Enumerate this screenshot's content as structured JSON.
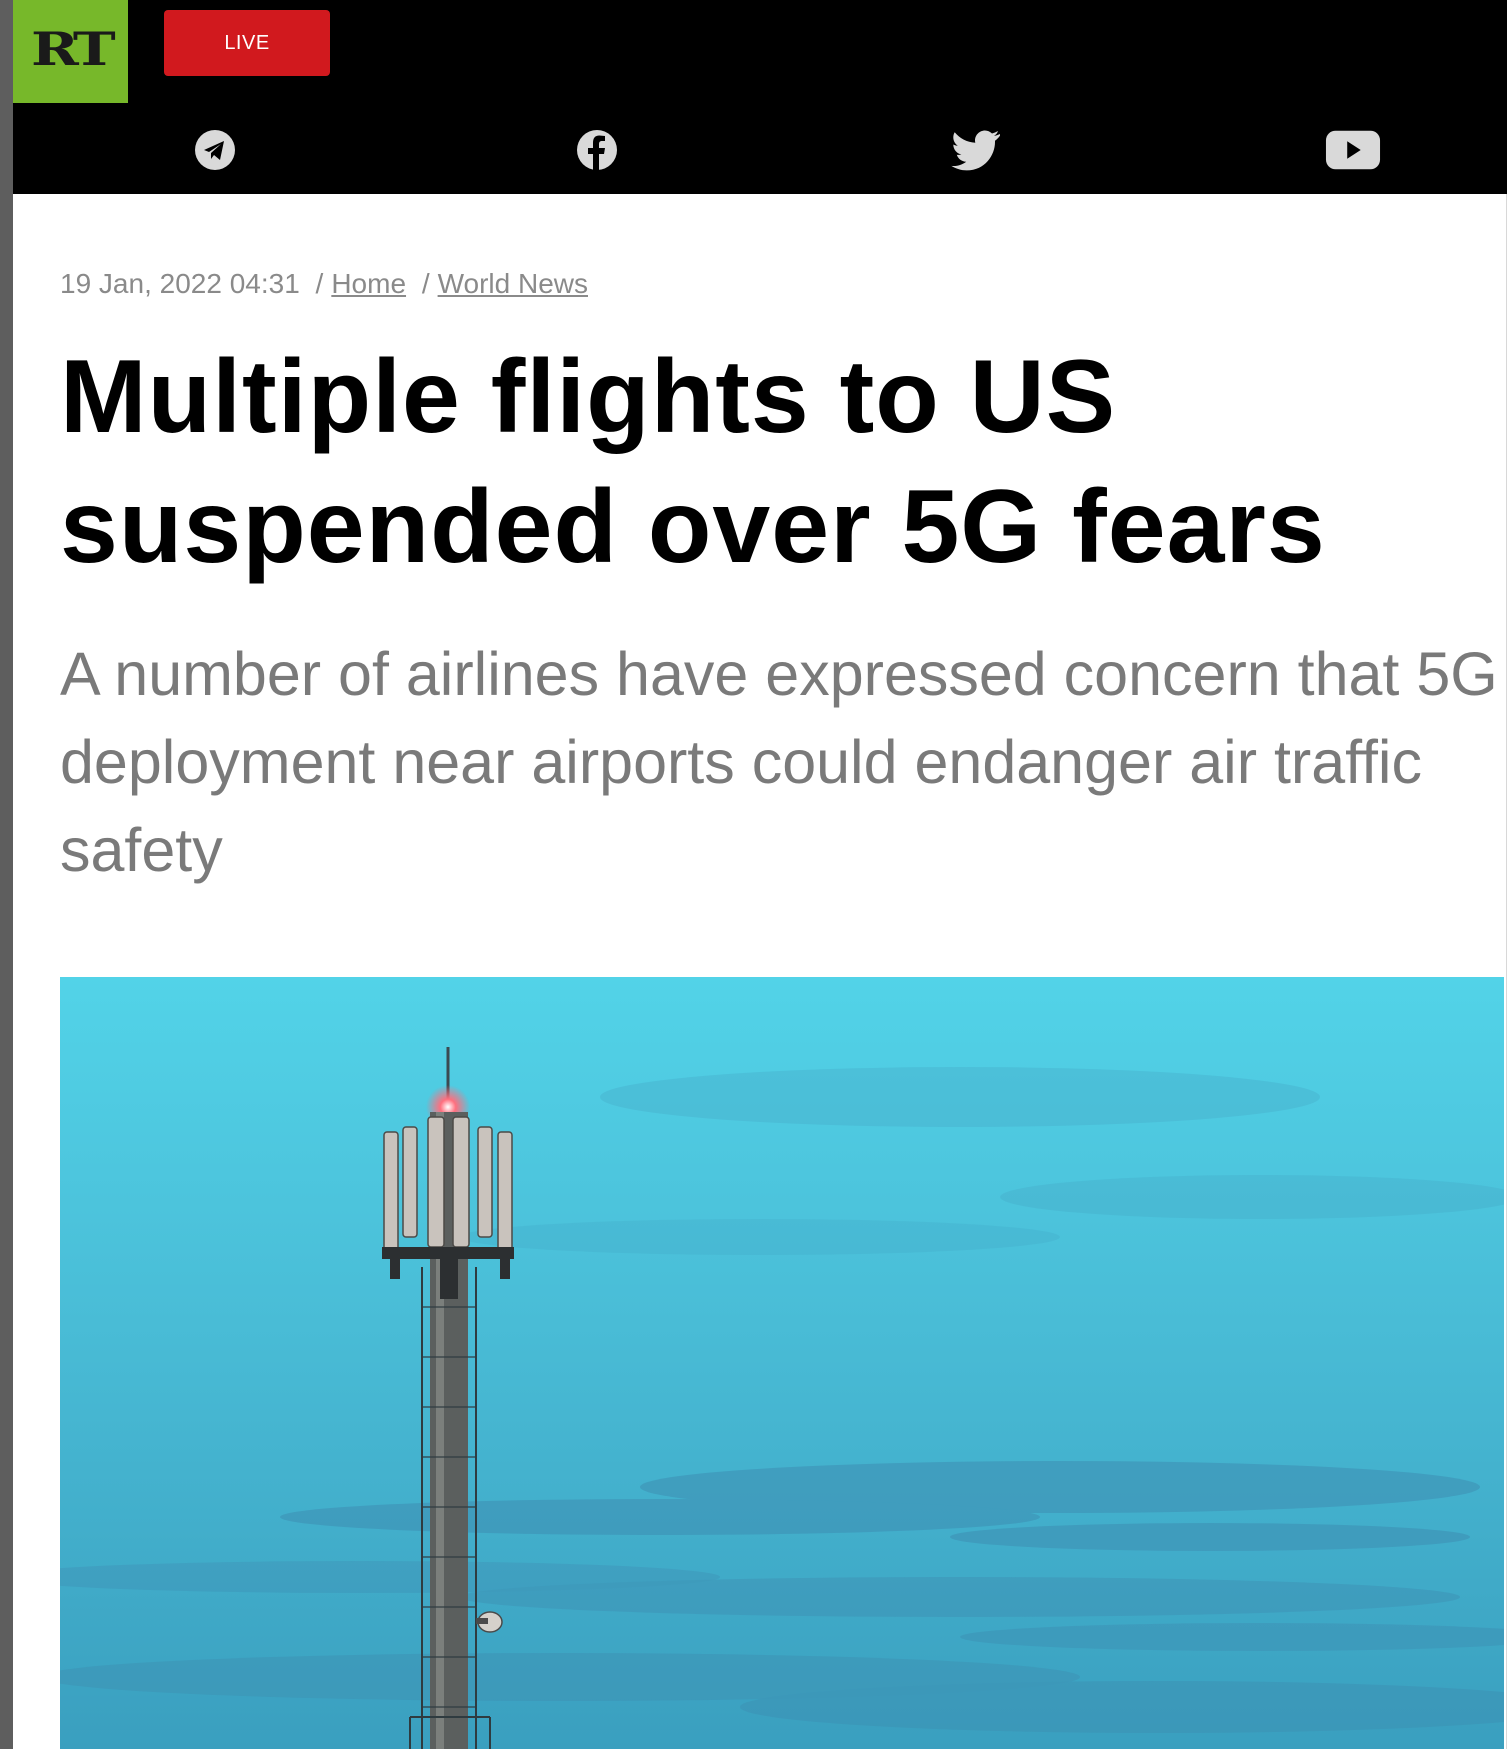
{
  "header": {
    "logo_text": "RT",
    "live_label": "LIVE",
    "colors": {
      "logo_bg": "#77b82a",
      "live_bg": "#d1191e",
      "bar_bg": "#000000"
    },
    "social": [
      {
        "icon": "telegram-icon"
      },
      {
        "icon": "facebook-icon"
      },
      {
        "icon": "twitter-icon"
      },
      {
        "icon": "youtube-icon"
      }
    ]
  },
  "article": {
    "date": "19 Jan, 2022 04:31",
    "separator": "/",
    "breadcrumbs": [
      "Home",
      "World News"
    ],
    "title": "Multiple flights to US suspended over 5G fears",
    "summary": "A number of airlines have expressed concern that 5G deployment near airports could endanger air traffic safety",
    "image": {
      "icon": "cell-tower-photo",
      "colors": {
        "sky_top": "#4fd0e6",
        "sky_bottom": "#3ba6c4"
      }
    }
  }
}
